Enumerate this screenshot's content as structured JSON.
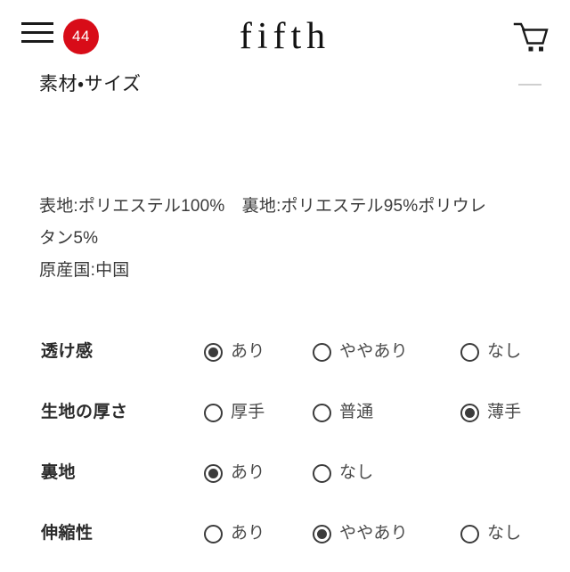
{
  "header": {
    "menu_icon": "hamburger-menu-icon",
    "badge_count": "44",
    "badge_color": "#d80c18",
    "logo_text": "fifth",
    "cart_icon": "shopping-cart-icon"
  },
  "section": {
    "title": "素材・サイズ",
    "collapse_icon": "minus-icon",
    "expanded": true
  },
  "material": {
    "line1": "表地:ポリエステル100%　裏地:ポリエステル95%ポリウレ",
    "line2": "タン5%",
    "line3": "原産国:中国"
  },
  "specs": [
    {
      "label": "透け感",
      "options": [
        {
          "label": "あり",
          "selected": true
        },
        {
          "label": "ややあり",
          "selected": false
        },
        {
          "label": "なし",
          "selected": false
        }
      ]
    },
    {
      "label": "生地の厚さ",
      "options": [
        {
          "label": "厚手",
          "selected": false
        },
        {
          "label": "普通",
          "selected": false
        },
        {
          "label": "薄手",
          "selected": true
        }
      ]
    },
    {
      "label": "裏地",
      "options": [
        {
          "label": "あり",
          "selected": true
        },
        {
          "label": "なし",
          "selected": false
        }
      ]
    },
    {
      "label": "伸縮性",
      "options": [
        {
          "label": "あり",
          "selected": false
        },
        {
          "label": "ややあり",
          "selected": true
        },
        {
          "label": "なし",
          "selected": false
        }
      ]
    }
  ]
}
